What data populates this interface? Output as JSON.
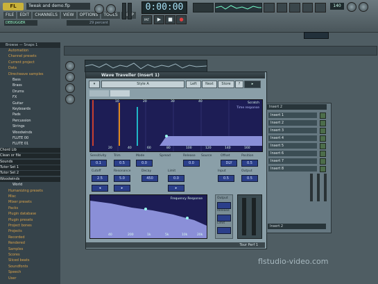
{
  "app": {
    "logo": "FL",
    "hint": "Tweak and demo.flp",
    "status": "DEBUGGER",
    "percent": "29 percent",
    "clock": "0:00:00",
    "tempo": "140"
  },
  "menu": [
    "FILE",
    "EDIT",
    "CHANNELS",
    "VIEW",
    "OPTIONS",
    "TOOLS",
    "HELP"
  ],
  "transport": {
    "play": "▶",
    "stop": "■",
    "rec": "●",
    "pat": "PAT",
    "song": "SONG"
  },
  "browser": {
    "title": "Browse — Snaps 1",
    "items": [
      {
        "label": "Automation",
        "level": "l0"
      },
      {
        "label": "Channel presets",
        "level": "l0"
      },
      {
        "label": "Current project",
        "level": "l0"
      },
      {
        "label": "Data",
        "level": "l0"
      },
      {
        "label": "Directwave samples",
        "level": "l0"
      },
      {
        "label": "Bass",
        "level": "l1"
      },
      {
        "label": "Brass",
        "level": "l1"
      },
      {
        "label": "Drums",
        "level": "l1"
      },
      {
        "label": "FX",
        "level": "l1"
      },
      {
        "label": "Guitar",
        "level": "l1"
      },
      {
        "label": "Keyboards",
        "level": "l1"
      },
      {
        "label": "Pads",
        "level": "l1"
      },
      {
        "label": "Percussion",
        "level": "l1"
      },
      {
        "label": "Strings",
        "level": "l1"
      },
      {
        "label": "Woodwinds",
        "level": "l1"
      },
      {
        "label": "FLUTE 00",
        "level": "l1"
      },
      {
        "label": "FLUTE 01",
        "level": "l1"
      },
      {
        "label": "Chord Lib",
        "level": "dk"
      },
      {
        "label": "Clean or file",
        "level": "dk"
      },
      {
        "label": "Sounds",
        "level": "dk"
      },
      {
        "label": "Tutor Set 1",
        "level": "dk"
      },
      {
        "label": "Tutor Set 2",
        "level": "dk"
      },
      {
        "label": "Woodwinds",
        "level": "dk"
      },
      {
        "label": "World",
        "level": "l1"
      },
      {
        "label": "Humanizing presets",
        "level": "l0"
      },
      {
        "label": "Misc",
        "level": "l0"
      },
      {
        "label": "Mixer presets",
        "level": "l0"
      },
      {
        "label": "Packs",
        "level": "l0"
      },
      {
        "label": "Plugin database",
        "level": "l0"
      },
      {
        "label": "Plugin presets",
        "level": "l0"
      },
      {
        "label": "Project bones",
        "level": "l0"
      },
      {
        "label": "Projects",
        "level": "l0"
      },
      {
        "label": "Recorded",
        "level": "l0"
      },
      {
        "label": "Rendered",
        "level": "l0"
      },
      {
        "label": "Samples",
        "level": "l0"
      },
      {
        "label": "Scores",
        "level": "l0"
      },
      {
        "label": "Sliced beats",
        "level": "l0"
      },
      {
        "label": "Soundfonts",
        "level": "l0"
      },
      {
        "label": "Speech",
        "level": "l0"
      },
      {
        "label": "User",
        "level": "l0"
      }
    ]
  },
  "plugin": {
    "title": "Wave Traveller (Insert 1)",
    "buttons": {
      "preset": "Style A",
      "prev": "Left",
      "next": "Next",
      "store": "Store",
      "help": "?"
    },
    "graph": {
      "label_top": "Scratch",
      "label_sub": "Time response",
      "top_ticks": [
        "10",
        "20",
        "30",
        "40"
      ],
      "bottom_ticks": [
        "20",
        "40",
        "60",
        "80",
        "100",
        "120",
        "140",
        "160"
      ]
    },
    "controls_row1": [
      "Sensitivity",
      "Trim",
      "Mode",
      "Curve",
      "Spread",
      "Release",
      "Source",
      "Offset",
      "Position"
    ],
    "values_row1": [
      "0.1",
      "0.5",
      "0.0",
      "0.0",
      "DLY",
      "0.5"
    ],
    "controls_row2": [
      "Cutoff",
      "Resonance",
      "Decay",
      "Limit",
      "Input",
      "Output"
    ],
    "values_row2": [
      "2.5",
      "5.0",
      "450",
      "0.0",
      "0.5",
      "0.5"
    ],
    "freq_label": "Frequency Response",
    "freq_ticks": [
      "40",
      "200",
      "1k",
      "5k",
      "10k",
      "20k"
    ],
    "side_labels": [
      "Output",
      "Release",
      "Limit",
      "Stereo",
      "Shape"
    ],
    "statusbar": "Tour Perf 1"
  },
  "mixer": {
    "header": "Insert 2",
    "rows": [
      "Insert 1",
      "Insert 2",
      "Insert 3",
      "Insert 4",
      "Insert 5",
      "Insert 6",
      "Insert 7",
      "Insert 8"
    ],
    "footer": "Insert 2"
  },
  "watermark": "flstudio-video.com"
}
